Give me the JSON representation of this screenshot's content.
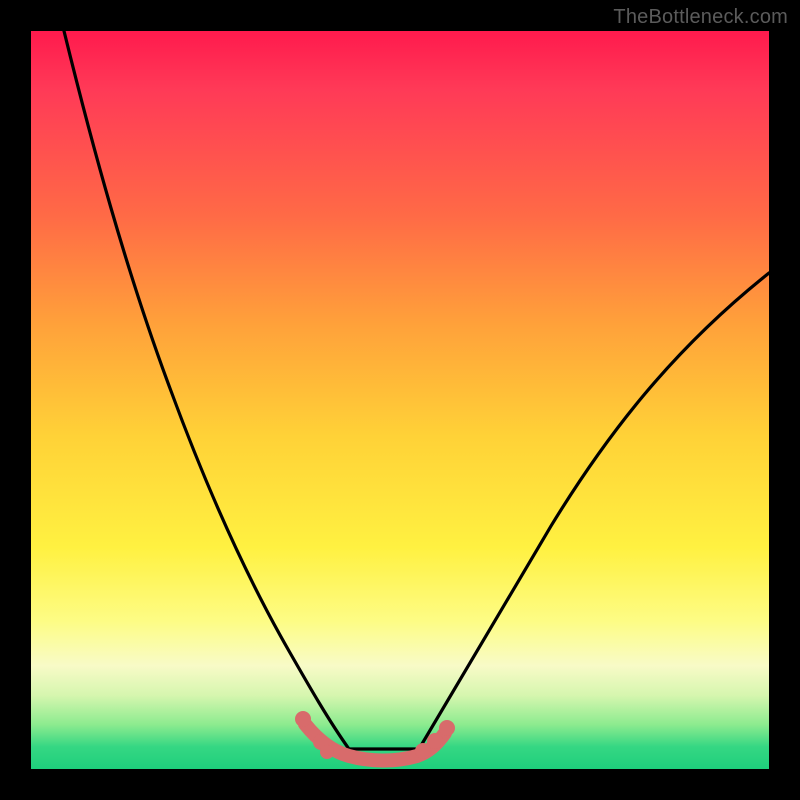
{
  "watermark": "TheBottleneck.com",
  "chart_data": {
    "type": "line",
    "title": "",
    "xlabel": "",
    "ylabel": "",
    "xlim": [
      0,
      100
    ],
    "ylim": [
      0,
      100
    ],
    "series": [
      {
        "name": "bottleneck-curve",
        "x": [
          4,
          6,
          8,
          10,
          12,
          14,
          16,
          18,
          20,
          22,
          24,
          26,
          28,
          30,
          32,
          34,
          36,
          38,
          40,
          42,
          44,
          55,
          60,
          65,
          70,
          75,
          80,
          85,
          90,
          95,
          100
        ],
        "values": [
          100,
          92,
          85,
          78,
          72,
          66,
          60,
          55,
          50,
          45,
          40,
          36,
          32,
          28,
          24,
          20,
          16,
          12,
          8,
          4,
          1,
          1,
          5,
          11,
          18,
          25,
          32,
          39,
          46,
          53,
          59
        ]
      },
      {
        "name": "highlighted-bottom-range",
        "x": [
          36,
          38,
          40,
          44,
          48,
          50,
          52
        ],
        "values": [
          4,
          2.5,
          1.5,
          1,
          1,
          1.5,
          2.5
        ]
      }
    ],
    "annotations": []
  },
  "colors": {
    "curve": "#000000",
    "highlight": "#d86b6b",
    "highlight_dot": "#d86b6b"
  }
}
